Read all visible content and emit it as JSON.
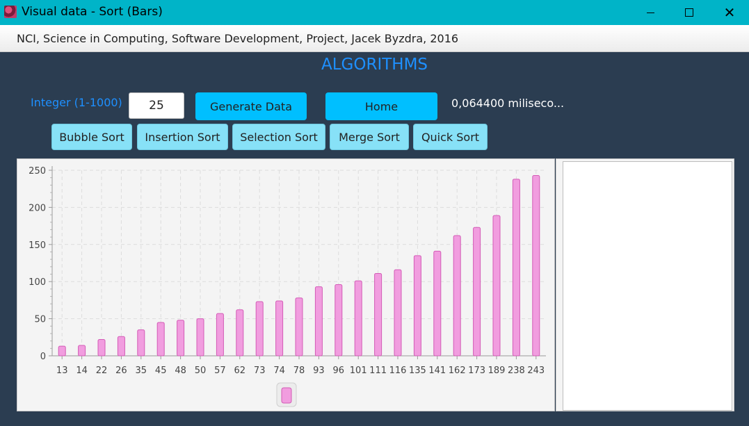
{
  "window": {
    "title": "Visual data - Sort (Bars)",
    "icon": "app-icon",
    "controls": [
      "minimize-icon",
      "maximize-icon",
      "close-icon"
    ]
  },
  "subtitle": "NCI, Science in Computing, Software Development, Project, Jacek Byzdra, 2016",
  "heading": "ALGORITHMS",
  "controls": {
    "integer_label": "Integer (1-1000)",
    "integer_value": "25",
    "generate_label": "Generate Data",
    "home_label": "Home",
    "timing_text": "0,064400 miliseco..."
  },
  "sort_buttons": {
    "bubble": "Bubble Sort",
    "insertion": "Insertion Sort",
    "selection": "Selection Sort",
    "merge": "Merge Sort",
    "quick": "Quick Sort"
  },
  "colors": {
    "titlebar": "#00b4c8",
    "background": "#2b3d51",
    "accent_text": "#1e90ff",
    "primary_button": "#00bfff",
    "sort_button": "#87e1f7",
    "bar_fill": "#f19ddf",
    "bar_stroke": "#d35bb6"
  },
  "chart_data": {
    "type": "bar",
    "categories": [
      "13",
      "14",
      "22",
      "26",
      "35",
      "45",
      "48",
      "50",
      "57",
      "62",
      "73",
      "74",
      "78",
      "93",
      "96",
      "101",
      "111",
      "116",
      "135",
      "141",
      "162",
      "173",
      "189",
      "238",
      "243"
    ],
    "values": [
      13,
      14,
      22,
      26,
      35,
      45,
      48,
      50,
      57,
      62,
      73,
      74,
      78,
      93,
      96,
      101,
      111,
      116,
      135,
      141,
      162,
      173,
      189,
      238,
      243
    ],
    "ylim": [
      0,
      250
    ],
    "yticks": [
      0,
      50,
      100,
      150,
      200,
      250
    ],
    "grid": true,
    "legend": "bottom-center"
  }
}
